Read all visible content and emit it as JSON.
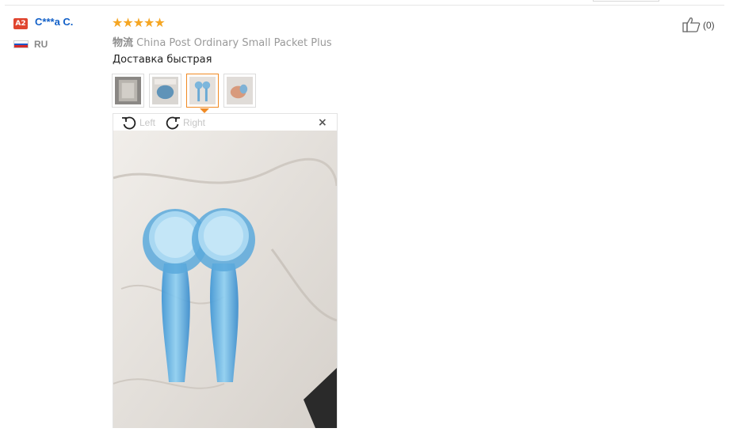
{
  "reviewer": {
    "level_badge": "A2",
    "name": "C***a C.",
    "country": "RU",
    "flag_colors": [
      "#ffffff",
      "#1c57c9",
      "#d62a2a"
    ]
  },
  "review": {
    "rating": 5,
    "stars": "★★★★★",
    "star_color": "#f5a623",
    "shipping_label": "物流",
    "shipping_method": "China Post Ordinary Small Packet Plus",
    "text": "Доставка быстрая"
  },
  "photos": {
    "count": 4,
    "active_index": 3
  },
  "viewer": {
    "rotate_left_label": "Left",
    "rotate_right_label": "Right",
    "close_symbol": "×"
  },
  "helpful": {
    "count_label": "(0)"
  },
  "colors": {
    "link": "#1260c8",
    "accent": "#f08a24",
    "badge": "#e0452f"
  }
}
